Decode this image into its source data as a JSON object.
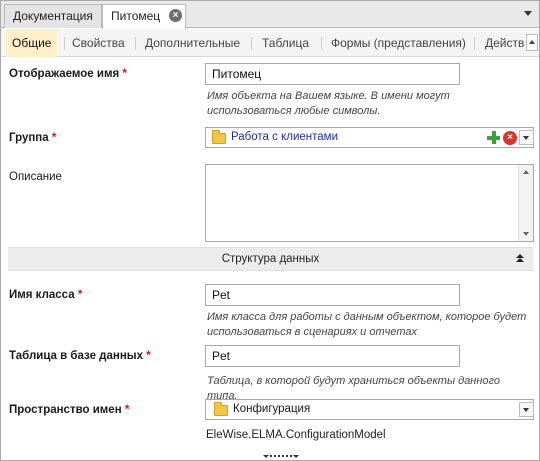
{
  "doc_tabs": [
    {
      "label": "Документация"
    },
    {
      "label": "Питомец"
    }
  ],
  "section_tabs": [
    {
      "label": "Общие"
    },
    {
      "label": "Свойства"
    },
    {
      "label": "Дополнительные"
    },
    {
      "label": "Таблица"
    },
    {
      "label": "Формы (представления)"
    },
    {
      "label": "Действи"
    }
  ],
  "fields": {
    "display_name": {
      "label": "Отображаемое имя",
      "required_mark": "*",
      "value": "Питомец",
      "hint": "Имя объекта на Вашем языке. В имени могут использоваться любые символы."
    },
    "group": {
      "label": "Группа",
      "required_mark": "*",
      "value": "Работа с клиентами"
    },
    "description": {
      "label": "Описание",
      "value": ""
    },
    "class_name": {
      "label": "Имя класса",
      "required_mark": "*",
      "value": "Pet",
      "hint": "Имя класса для работы с данным объектом, которое будет использоваться в сценариях и отчетах"
    },
    "db_table": {
      "label": "Таблица в базе данных",
      "required_mark": "*",
      "value": "Pet",
      "hint": "Таблица, в которой будут храниться объекты данного типа."
    },
    "namespace": {
      "label": "Пространство имен",
      "required_mark": "*",
      "value": "Конфигурация",
      "full_value": "EleWise.ELMA.ConfigurationModel"
    }
  },
  "data_structure_section": {
    "title": "Структура данных"
  },
  "colors": {
    "active_tab_bg": "#fdefc8",
    "required": "#dd1111",
    "link": "#1c2fa8",
    "add_green": "#3aa23a",
    "delete_red": "#e0322b"
  }
}
